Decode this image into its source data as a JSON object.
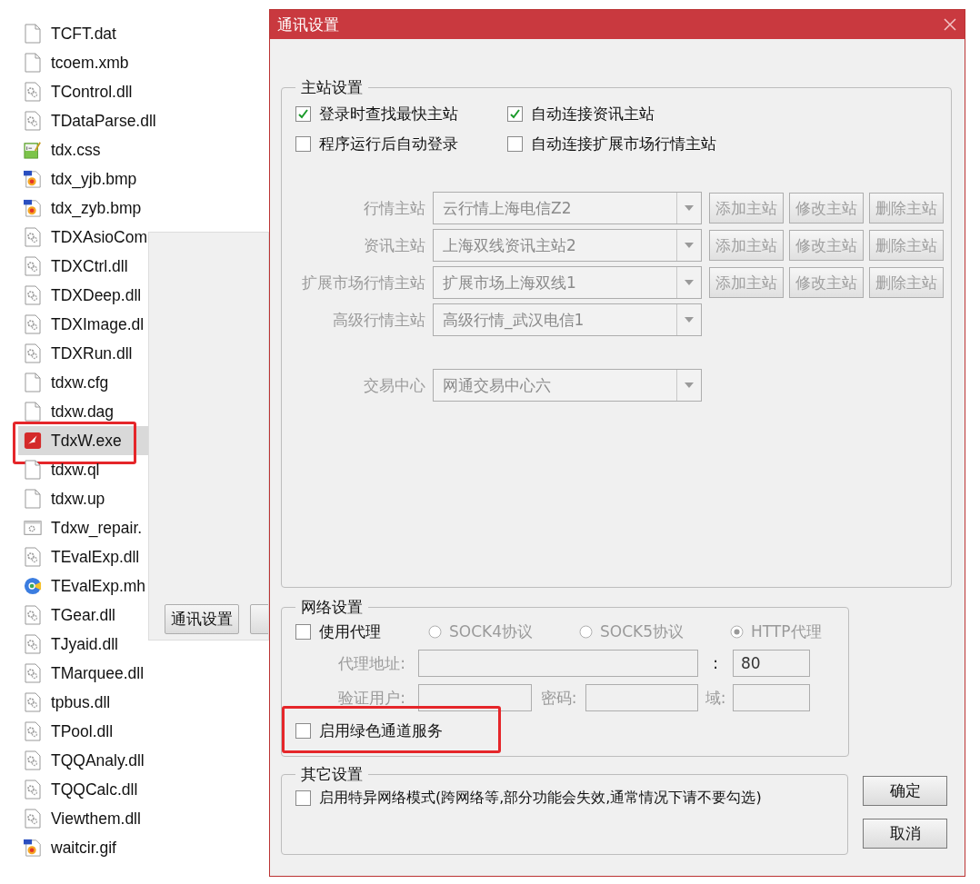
{
  "file_list": {
    "items": [
      {
        "name": "TCFT.dat",
        "kind": "blank",
        "selected": false,
        "highlighted": false
      },
      {
        "name": "tcoem.xmb",
        "kind": "blank",
        "selected": false,
        "highlighted": false
      },
      {
        "name": "TControl.dll",
        "kind": "dll",
        "selected": false,
        "highlighted": false
      },
      {
        "name": "TDataParse.dll",
        "kind": "dll",
        "selected": false,
        "highlighted": false
      },
      {
        "name": "tdx.css",
        "kind": "css",
        "selected": false,
        "highlighted": false
      },
      {
        "name": "tdx_yjb.bmp",
        "kind": "image",
        "selected": false,
        "highlighted": false
      },
      {
        "name": "tdx_zyb.bmp",
        "kind": "image",
        "selected": false,
        "highlighted": false
      },
      {
        "name": "TDXAsioCom",
        "kind": "dll",
        "selected": false,
        "highlighted": false
      },
      {
        "name": "TDXCtrl.dll",
        "kind": "dll",
        "selected": false,
        "highlighted": false
      },
      {
        "name": "TDXDeep.dll",
        "kind": "dll",
        "selected": false,
        "highlighted": false
      },
      {
        "name": "TDXImage.dl",
        "kind": "dll",
        "selected": false,
        "highlighted": false
      },
      {
        "name": "TDXRun.dll",
        "kind": "dll",
        "selected": false,
        "highlighted": false
      },
      {
        "name": "tdxw.cfg",
        "kind": "blank",
        "selected": false,
        "highlighted": false
      },
      {
        "name": "tdxw.dag",
        "kind": "blank",
        "selected": false,
        "highlighted": false
      },
      {
        "name": "TdxW.exe",
        "kind": "exe",
        "selected": true,
        "highlighted": true
      },
      {
        "name": "tdxw.ql",
        "kind": "blank",
        "selected": false,
        "highlighted": false
      },
      {
        "name": "tdxw.up",
        "kind": "blank",
        "selected": false,
        "highlighted": false
      },
      {
        "name": "Tdxw_repair.",
        "kind": "app",
        "selected": false,
        "highlighted": false
      },
      {
        "name": "TEvalExp.dll",
        "kind": "dll",
        "selected": false,
        "highlighted": false
      },
      {
        "name": "TEvalExp.mh",
        "kind": "web",
        "selected": false,
        "highlighted": false
      },
      {
        "name": "TGear.dll",
        "kind": "dll",
        "selected": false,
        "highlighted": false
      },
      {
        "name": "TJyaid.dll",
        "kind": "dll",
        "selected": false,
        "highlighted": false
      },
      {
        "name": "TMarquee.dll",
        "kind": "dll",
        "selected": false,
        "highlighted": false
      },
      {
        "name": "tpbus.dll",
        "kind": "dll",
        "selected": false,
        "highlighted": false
      },
      {
        "name": "TPool.dll",
        "kind": "dll",
        "selected": false,
        "highlighted": false
      },
      {
        "name": "TQQAnaly.dll",
        "kind": "dll",
        "selected": false,
        "highlighted": false
      },
      {
        "name": "TQQCalc.dll",
        "kind": "dll",
        "selected": false,
        "highlighted": false
      },
      {
        "name": "Viewthem.dll",
        "kind": "dll",
        "selected": false,
        "highlighted": false
      },
      {
        "name": "waitcir.gif",
        "kind": "image",
        "selected": false,
        "highlighted": false
      }
    ]
  },
  "back_window": {
    "button": "通讯设置"
  },
  "dialog": {
    "title": "通讯设置",
    "master_group": {
      "title": "主站设置",
      "options": [
        {
          "label": "登录时查找最快主站",
          "checked": true
        },
        {
          "label": "自动连接资讯主站",
          "checked": true
        },
        {
          "label": "程序运行后自动登录",
          "checked": false
        },
        {
          "label": "自动连接扩展市场行情主站",
          "checked": false
        }
      ],
      "stations": [
        {
          "label": "行情主站",
          "value": "云行情上海电信Z2",
          "disabled": true,
          "buttons": [
            "添加主站",
            "修改主站",
            "删除主站"
          ]
        },
        {
          "label": "资讯主站",
          "value": "上海双线资讯主站2",
          "disabled": true,
          "buttons": [
            "添加主站",
            "修改主站",
            "删除主站"
          ]
        },
        {
          "label": "扩展市场行情主站",
          "value": "扩展市场上海双线1",
          "disabled": true,
          "buttons": [
            "添加主站",
            "修改主站",
            "删除主站"
          ]
        },
        {
          "label": "高级行情主站",
          "value": "高级行情_武汉电信1",
          "disabled": true
        }
      ],
      "trading_center": {
        "label": "交易中心",
        "value": "网通交易中心六",
        "disabled": true
      }
    },
    "network_group": {
      "title": "网络设置",
      "use_proxy": {
        "label": "使用代理",
        "checked": false
      },
      "protocols": [
        {
          "label": "SOCK4协议",
          "selected": false,
          "disabled": true
        },
        {
          "label": "SOCK5协议",
          "selected": false,
          "disabled": true
        },
        {
          "label": "HTTP代理",
          "selected": true,
          "disabled": true
        }
      ],
      "proxy_fields": {
        "disabled": true,
        "address_label": "代理地址:",
        "separator": ":",
        "port": "80",
        "user_label": "验证用户:",
        "password_label": "密码:",
        "domain_label": "域:"
      },
      "green_channel": {
        "label": "启用绿色通道服务",
        "checked": false,
        "highlighted": true
      }
    },
    "other_group": {
      "title": "其它设置",
      "special_mode": {
        "label": "启用特异网络模式(跨网络等,部分功能会失效,通常情况下请不要勾选)",
        "checked": false
      }
    },
    "buttons": [
      "确定",
      "取消"
    ]
  }
}
